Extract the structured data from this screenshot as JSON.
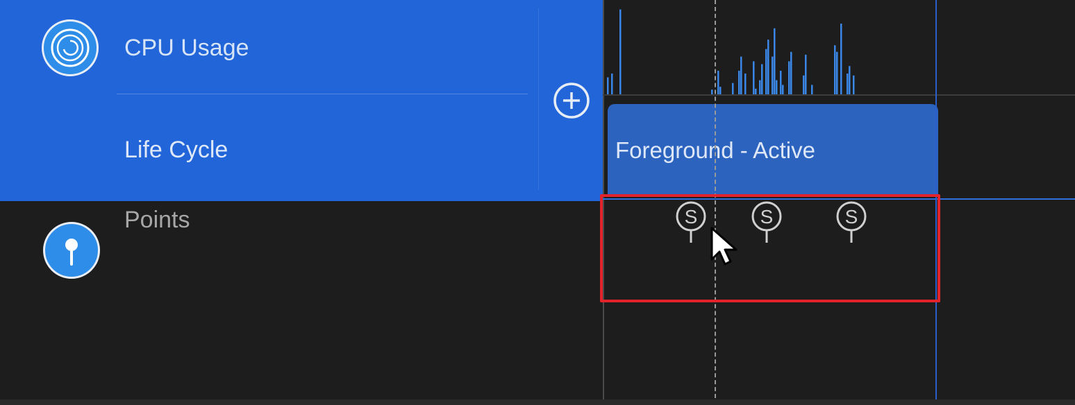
{
  "instruments": {
    "cpu": {
      "label": "CPU Usage",
      "icon": "cpu-spiral-icon"
    },
    "lifecycle": {
      "label": "Life Cycle"
    },
    "points": {
      "label": "Points",
      "icon": "pin-icon"
    }
  },
  "add_button": {
    "icon": "plus-circle-icon"
  },
  "timeline": {
    "cpu_bars": [
      18,
      0,
      22,
      0,
      0,
      0,
      90,
      0,
      0,
      0,
      0,
      0,
      0,
      0,
      0,
      0,
      0,
      0,
      0,
      0,
      0,
      0,
      0,
      0,
      0,
      0,
      0,
      0,
      0,
      0,
      0,
      0,
      0,
      0,
      0,
      0,
      0,
      0,
      0,
      0,
      0,
      0,
      0,
      0,
      0,
      0,
      0,
      0,
      0,
      0,
      5,
      0,
      0,
      25,
      8,
      0,
      0,
      0,
      0,
      0,
      12,
      0,
      0,
      25,
      40,
      0,
      22,
      0,
      0,
      0,
      35,
      6,
      0,
      15,
      32,
      0,
      48,
      58,
      0,
      40,
      70,
      15,
      0,
      25,
      10,
      0,
      0,
      35,
      45,
      0,
      0,
      0,
      0,
      0,
      20,
      42,
      0,
      0,
      10,
      0,
      0,
      0,
      0,
      0,
      0,
      0,
      0,
      0,
      0,
      52,
      45,
      0,
      75,
      0,
      0,
      22,
      30,
      0,
      20,
      0,
      0,
      0,
      0,
      0,
      0,
      0
    ],
    "lifecycle_state": "Foreground - Active",
    "signposts": [
      "S",
      "S",
      "S"
    ]
  },
  "colors": {
    "selected_row": "#2165d9",
    "cpu_bar": "#3a87e8",
    "lifecycle_bar": "#2c63be",
    "highlight": "#e3232b"
  }
}
